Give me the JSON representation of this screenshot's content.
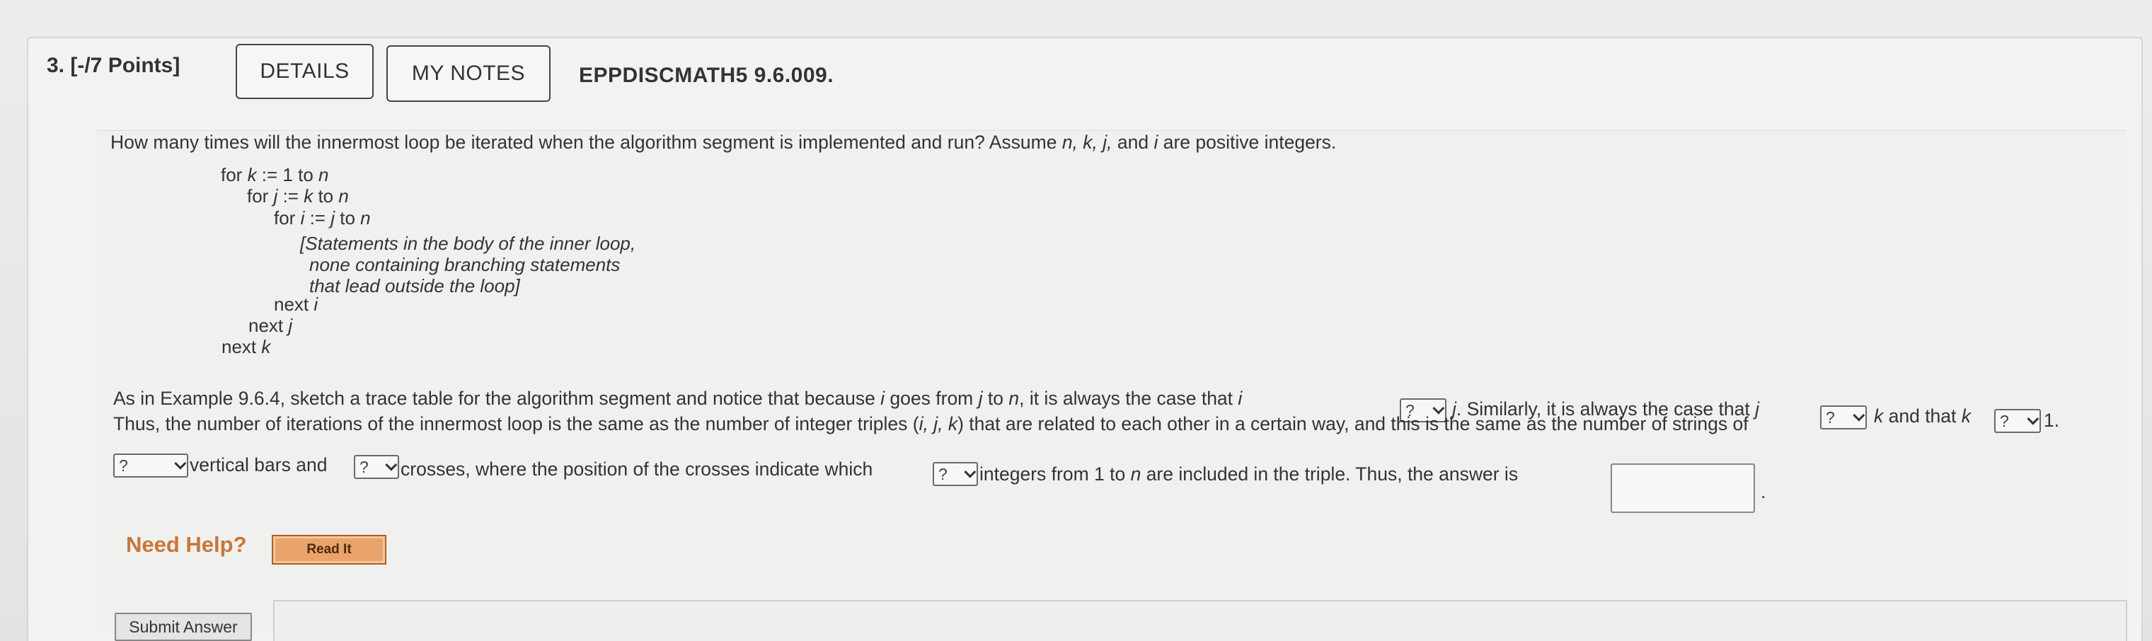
{
  "header": {
    "question_label": "3. [-/7 Points]",
    "details_label": "DETAILS",
    "my_notes_label": "MY NOTES",
    "source_code": "EPPDISCMATH5 9.6.009."
  },
  "question": {
    "prompt_a": "How many times will the innermost loop be iterated when the algorithm segment is implemented and run? Assume ",
    "prompt_vars": "n, k, j,",
    "prompt_b": " and ",
    "prompt_var_i": "i",
    "prompt_c": " are positive integers.",
    "algorithm": {
      "line1_a": "for ",
      "line1_var": "k",
      "line1_b": " := 1 to ",
      "line1_var2": "n",
      "line2_a": "for ",
      "line2_var": "j",
      "line2_b": " := ",
      "line2_var2": "k",
      "line2_c": " to ",
      "line2_var3": "n",
      "line3_a": "for ",
      "line3_var": "i",
      "line3_b": " := ",
      "line3_var2": "j",
      "line3_c": " to ",
      "line3_var3": "n",
      "body1": "[Statements in the body of the inner loop,",
      "body2": "none containing branching statements",
      "body3": "that lead outside the loop]",
      "next_i_a": "next ",
      "next_i_var": "i",
      "next_j_a": "next ",
      "next_j_var": "j",
      "next_k_a": "next ",
      "next_k_var": "k"
    },
    "para_line1_a": "As in Example 9.6.4, sketch a trace table for the algorithm segment and notice that because ",
    "para_line1_i": "i",
    "para_line1_b": " goes from ",
    "para_line1_j": "j",
    "para_line1_c": " to ",
    "para_line1_n": "n",
    "para_line1_d": ", it is always the case that ",
    "para_line1_i2": "i",
    "para_line1_e": "j",
    "para_line1_f": ". Similarly, it is always the case that ",
    "para_line1_j2": "j",
    "para_line1_k": "k",
    "para_line1_g": " and that ",
    "para_line1_k2": "k",
    "para_line1_h": " 1.",
    "para_line2_a": "Thus, the number of iterations of the innermost loop is the same as the number of integer triples (",
    "para_line2_vars": "i, j, k",
    "para_line2_b": ") that are related to each other in a certain way, and this is the same as the number of strings of",
    "para_line3_a": " vertical bars and ",
    "para_line3_b": " crosses, where the position of the crosses indicate which ",
    "para_line3_c": " integers from 1 to ",
    "para_line3_n": "n",
    "para_line3_d": " are included in the triple. Thus, the answer is",
    "para_line3_e": ".",
    "dropdown_placeholder": "?"
  },
  "help": {
    "need_help_label": "Need Help?",
    "read_it_label": "Read It"
  },
  "submit_label": "Submit Answer"
}
